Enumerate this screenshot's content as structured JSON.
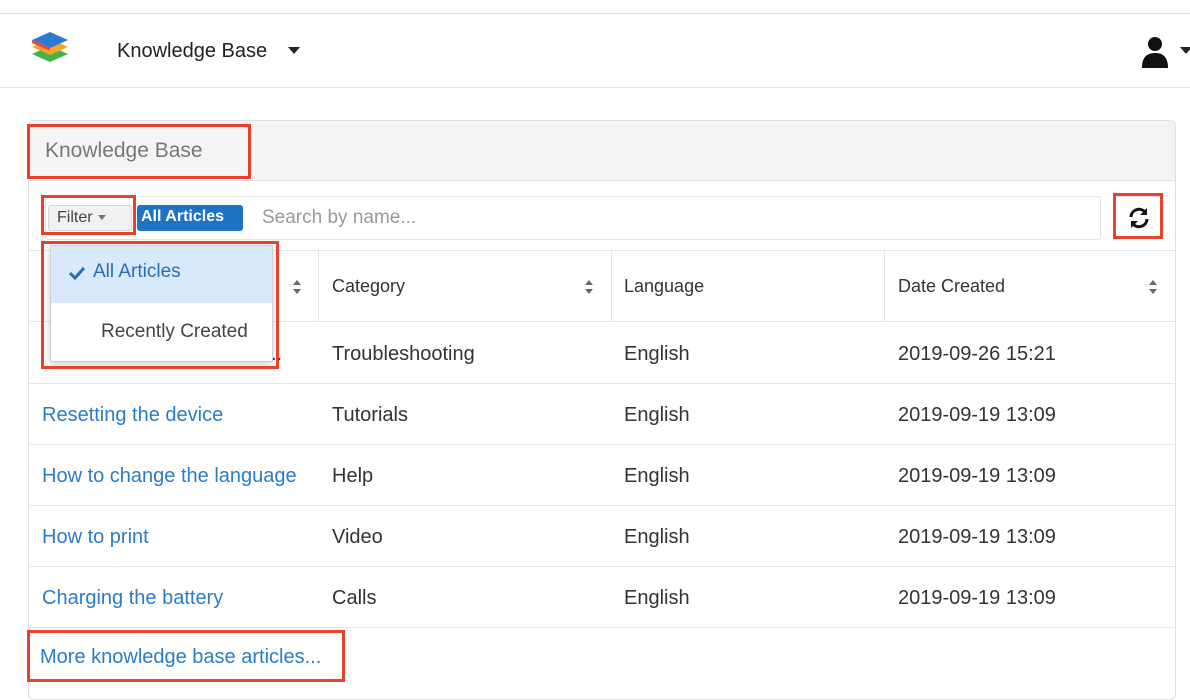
{
  "topbar": {
    "module_name": "Knowledge Base"
  },
  "dashlet": {
    "title": "Knowledge Base",
    "filter_label": "Filter",
    "active_filter": "All Articles",
    "search_placeholder": "Search by name...",
    "columns": [
      "Category",
      "Language",
      "Date Created"
    ],
    "rows": [
      {
        "name": "",
        "name_visible": "..",
        "category": "Troubleshooting",
        "language": "English",
        "date": "2019-09-26 15:21"
      },
      {
        "name": "Resetting the device",
        "category": "Tutorials",
        "language": "English",
        "date": "2019-09-19 13:09"
      },
      {
        "name": "How to change the language",
        "category": "Help",
        "language": "English",
        "date": "2019-09-19 13:09"
      },
      {
        "name": "How to print",
        "category": "Video",
        "language": "English",
        "date": "2019-09-19 13:09"
      },
      {
        "name": "Charging the battery",
        "category": "Calls",
        "language": "English",
        "date": "2019-09-19 13:09"
      }
    ],
    "more_link": "More knowledge base articles..."
  },
  "filter_dropdown": {
    "items": [
      "All Articles",
      "Recently Created"
    ],
    "selected": "All Articles"
  },
  "colors": {
    "accent": "#1f73c4",
    "link": "#2a7cc8",
    "highlight": "#e8412c",
    "dropdown_active_bg": "#d7e9fb"
  }
}
